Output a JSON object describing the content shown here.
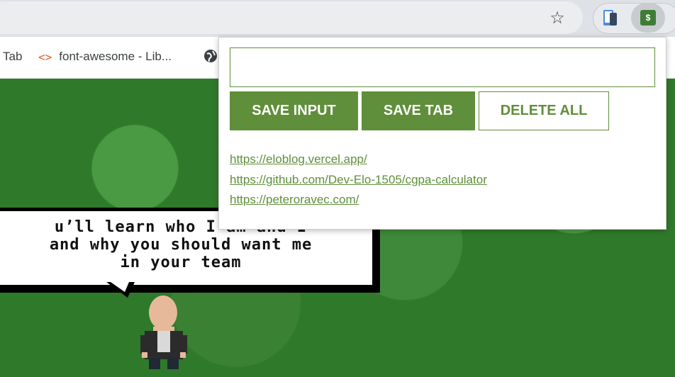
{
  "toolbar": {
    "bookmark_star_icon": "star-outline-icon",
    "extensions": [
      {
        "icon": "phone-clipboard-extension-icon"
      },
      {
        "icon": "dollar-leads-extension-icon",
        "glyph": "$",
        "color": "#3f7d36"
      }
    ]
  },
  "bookmarks": {
    "items": [
      {
        "label": "Tab"
      },
      {
        "label": "font-awesome - Lib...",
        "icon": "code-brackets-icon"
      },
      {
        "label": "",
        "icon": "globe-icon"
      }
    ]
  },
  "scene": {
    "speech": [
      "u’ll learn who I am and I",
      "and why you should want me",
      "in your team"
    ]
  },
  "popup": {
    "input": {
      "value": "",
      "placeholder": ""
    },
    "buttons": {
      "save_input": "SAVE INPUT",
      "save_tab": "SAVE TAB",
      "delete_all": "DELETE ALL"
    },
    "leads": [
      "https://eloblog.vercel.app/",
      "https://github.com/Dev-Elo-1505/cgpa-calculator",
      "https://peteroravec.com/"
    ],
    "accent_color": "#5f8f3a"
  }
}
